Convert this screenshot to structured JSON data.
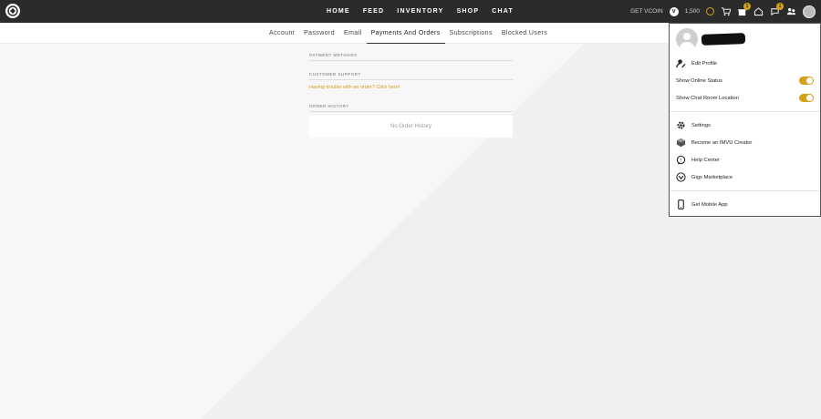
{
  "nav": {
    "items": [
      "HOME",
      "FEED",
      "INVENTORY",
      "SHOP",
      "CHAT"
    ],
    "get_vcoin": "GET VCOIN",
    "credits": "1,500",
    "notification_counts": {
      "gifts": "1",
      "messages": "1"
    }
  },
  "subnav": {
    "tabs": [
      "Account",
      "Password",
      "Email",
      "Payments And Orders",
      "Subscriptions",
      "Blocked Users"
    ],
    "active_tab": "Payments And Orders"
  },
  "content": {
    "payment_methods_header": "PAYMENT METHODS",
    "customer_support_header": "CUSTOMER SUPPORT",
    "support_link": "Having trouble with an order? Click here!",
    "order_history_header": "ORDER HISTORY",
    "order_history_empty": "No Order History"
  },
  "dropdown": {
    "edit_profile": "Edit Profile",
    "show_online_status": "Show Online Status",
    "show_online_status_on": true,
    "show_chat_room_location": "Show Chat Room Location",
    "show_chat_room_location_on": true,
    "settings": "Settings",
    "become_creator": "Become an IMVU Creator",
    "help_center": "Help Center",
    "gigs_marketplace": "Gigs Marketplace",
    "get_mobile_app": "Get Mobile App"
  },
  "colors": {
    "accent": "#d4a017",
    "topbar": "#2b2b2b",
    "link": "#d49a1b"
  }
}
